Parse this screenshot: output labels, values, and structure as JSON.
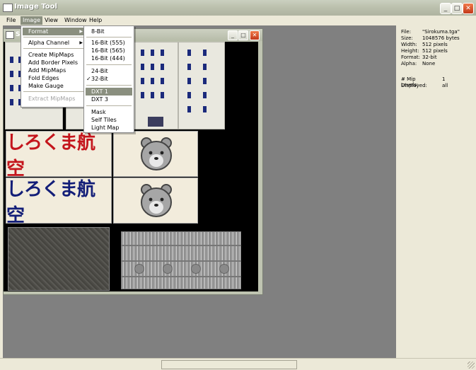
{
  "window": {
    "title": "Image Tool",
    "minimize": "_",
    "maximize": "□",
    "close": "✕"
  },
  "menubar": [
    "File",
    "Image",
    "View",
    "Window",
    "Help"
  ],
  "image_menu": {
    "items": [
      "Format",
      "Alpha Channel",
      "Create MipMaps",
      "Add Border Pixels",
      "Add MipMaps",
      "Fold Edges",
      "Make Gauge",
      "Extract MipMaps"
    ],
    "submenu_arrow": "▶"
  },
  "format_menu": {
    "items": [
      "8-Bit",
      "16-Bit (555)",
      "16-Bit (565)",
      "16-Bit (444)",
      "24-Bit",
      "32-Bit",
      "DXT 1",
      "DXT 3",
      "Mask",
      "Self Tiles",
      "Light Map"
    ],
    "checkmark": "✓"
  },
  "child_window": {
    "title": "S",
    "minimize": "_",
    "maximize": "□",
    "close": "✕"
  },
  "texture": {
    "label_red": "しろくま航空",
    "label_blue": "しろくま航空",
    "label_red_color": "#c4151c",
    "label_blue_color": "#131e78"
  },
  "info": [
    {
      "key": "File:",
      "value": "\"Sirokuma.tga\""
    },
    {
      "key": "Size:",
      "value": "1048576 bytes"
    },
    {
      "key": "Width:",
      "value": "512 pixels"
    },
    {
      "key": "Height:",
      "value": "512 pixels"
    },
    {
      "key": "Format:",
      "value": "32-bit"
    },
    {
      "key": "Alpha:",
      "value": "None"
    },
    {
      "key": "# Mip Levels:",
      "value": "1"
    },
    {
      "key": "Displayed:",
      "value": "all"
    }
  ]
}
